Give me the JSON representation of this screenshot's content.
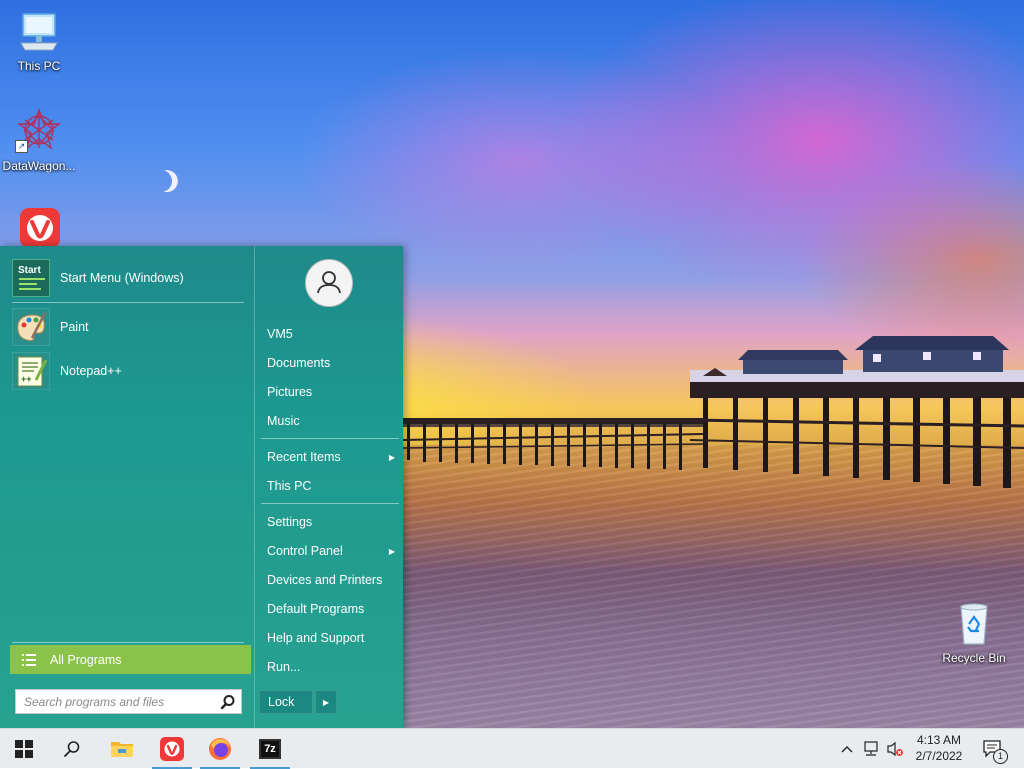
{
  "desktop": {
    "icons": [
      {
        "label": "This PC",
        "icon": "monitor-icon"
      },
      {
        "label": "DataWagon...",
        "icon": "datawagon-icon"
      },
      {
        "label": "Vivaldi",
        "icon": "vivaldi-icon"
      },
      {
        "label": "Recycle Bin",
        "icon": "recycle-bin-icon"
      }
    ]
  },
  "start_menu": {
    "programs": [
      {
        "label": "Start Menu (Windows)",
        "icon": "start-menu-icon",
        "icon_text": "Start"
      },
      {
        "label": "Paint",
        "icon": "paint-palette-icon"
      },
      {
        "label": "Notepad++",
        "icon": "notepad-plus-plus-icon"
      }
    ],
    "all_programs": {
      "label": "All Programs",
      "icon": "list-icon",
      "color": "#8bc34a"
    },
    "search": {
      "placeholder": "Search programs and files",
      "value": ""
    },
    "right_items": [
      {
        "label": "VM5",
        "submenu": false
      },
      {
        "label": "Documents",
        "submenu": false
      },
      {
        "label": "Pictures",
        "submenu": false
      },
      {
        "label": "Music",
        "submenu": false
      },
      {
        "label": "Recent Items",
        "submenu": true
      },
      {
        "label": "This PC",
        "submenu": false
      },
      {
        "label": "Settings",
        "submenu": false
      },
      {
        "label": "Control Panel",
        "submenu": true
      },
      {
        "label": "Devices and Printers",
        "submenu": false
      },
      {
        "label": "Default Programs",
        "submenu": false
      },
      {
        "label": "Help and Support",
        "submenu": false
      },
      {
        "label": "Run...",
        "submenu": false
      }
    ],
    "lock": {
      "label": "Lock"
    },
    "background": "#1f9a8f"
  },
  "taskbar": {
    "buttons": [
      {
        "name": "start",
        "icon": "windows-logo-icon"
      },
      {
        "name": "search",
        "icon": "search-icon"
      },
      {
        "name": "file-explorer",
        "icon": "folder-icon"
      },
      {
        "name": "vivaldi",
        "icon": "vivaldi-icon"
      },
      {
        "name": "firefox",
        "icon": "firefox-icon"
      },
      {
        "name": "7zip",
        "icon": "7zip-icon",
        "icon_text": "7z"
      }
    ],
    "tray": {
      "time": "4:13 AM",
      "date": "2/7/2022",
      "notification_count": "1"
    }
  }
}
